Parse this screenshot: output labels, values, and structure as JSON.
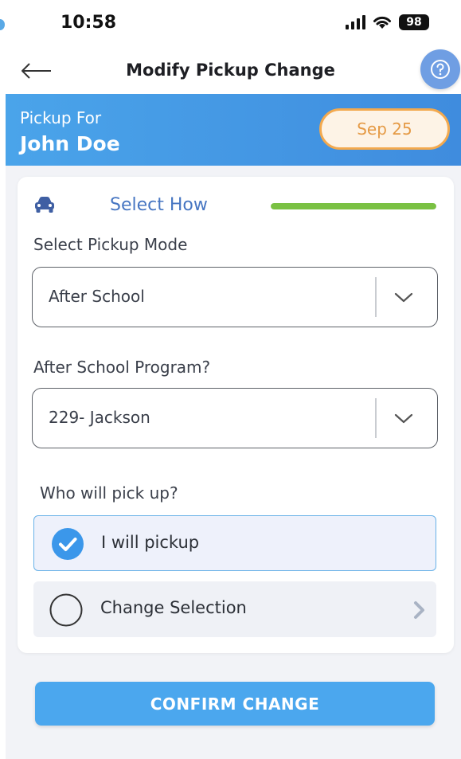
{
  "status_bar": {
    "time": "10:58",
    "battery": "98"
  },
  "nav": {
    "title": "Modify Pickup Change"
  },
  "banner": {
    "label": "Pickup For",
    "name": "John Doe",
    "date": "Sep 25"
  },
  "step": {
    "label": "Select How",
    "progress_percent": 100,
    "progress_color": "#7ac143"
  },
  "fields": {
    "pickup_mode": {
      "label": "Select Pickup Mode",
      "value": "After School"
    },
    "program": {
      "label": "After School Program?",
      "value": "229- Jackson"
    }
  },
  "pickup": {
    "question": "Who will pick up?",
    "options": [
      {
        "label": "I will pickup",
        "selected": true
      },
      {
        "label": "Change Selection",
        "selected": false
      }
    ]
  },
  "confirm_label": "CONFIRM CHANGE",
  "colors": {
    "accent": "#4ba7ee",
    "date_orange": "#f3a94e",
    "progress_green": "#7ac143"
  }
}
